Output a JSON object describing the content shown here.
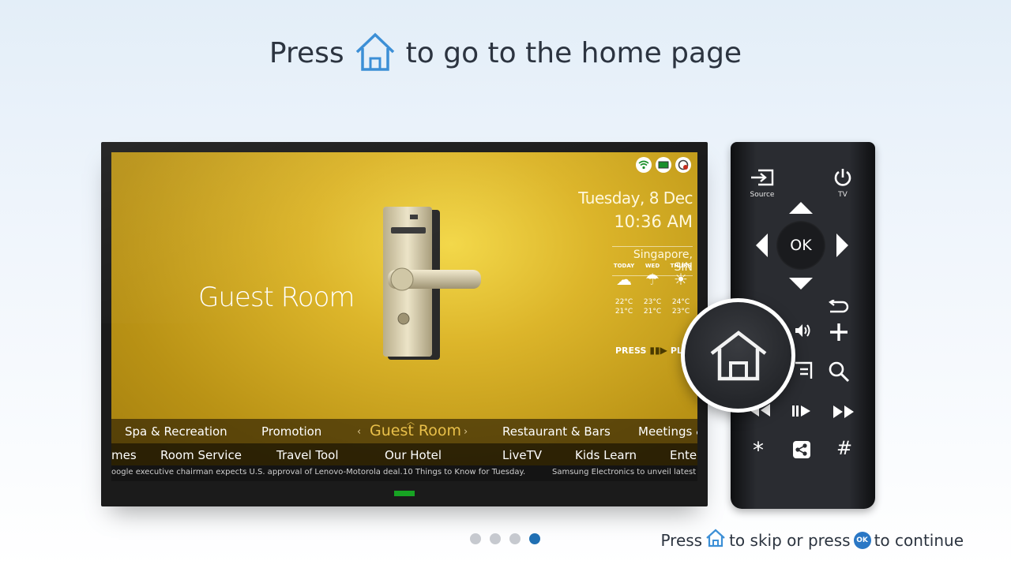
{
  "headline": {
    "prefix": "Press",
    "suffix": "to go to the home page",
    "icon": "home-icon"
  },
  "tv_screen": {
    "title": "Guest Room",
    "date": "Tuesday, 8 Dec",
    "time": "10:36 AM",
    "city": "Singapore, SIN",
    "status_icons": [
      "wifi-icon",
      "tv-icon",
      "alert-icon"
    ],
    "weather": [
      {
        "day": "TODAY",
        "icon": "cloudy-icon",
        "glyph": "☁",
        "hi": "22°C",
        "lo": "21°C"
      },
      {
        "day": "WED",
        "icon": "rain-icon",
        "glyph": "☂",
        "hi": "23°C",
        "lo": "21°C"
      },
      {
        "day": "THURS",
        "icon": "sun-icon",
        "glyph": "☀",
        "hi": "24°C",
        "lo": "23°C"
      }
    ],
    "press_play": {
      "press": "PRESS",
      "play": "PLA"
    },
    "menu_row1": [
      "Spa & Recreation",
      "Promotion",
      "Guest Room",
      "Restaurant & Bars",
      "Meetings &"
    ],
    "menu_row2": [
      "mes",
      "Room Service",
      "Travel Tool",
      "Our Hotel",
      "LiveTV",
      "Kids Learn",
      "Ente"
    ],
    "ticker": [
      "oogle executive chairman expects U.S. approval of Lenovo-Motorola deal.",
      "10 Things to Know for Tuesday.",
      "Samsung Electronics to unveil latest te"
    ]
  },
  "remote": {
    "source_label": "Source",
    "tv_label": "TV",
    "ok_label": "OK",
    "symbols": {
      "star": "*",
      "hash": "#"
    }
  },
  "pagination": {
    "count": 4,
    "active": 4
  },
  "bottom_hint": {
    "press": "Press",
    "skip": "to skip or press",
    "ok": "OK",
    "continue": "to continue"
  },
  "colors": {
    "accent": "#1f6fb3",
    "screen_gold": "#d7b02a",
    "indicator_green": "#17a323"
  }
}
